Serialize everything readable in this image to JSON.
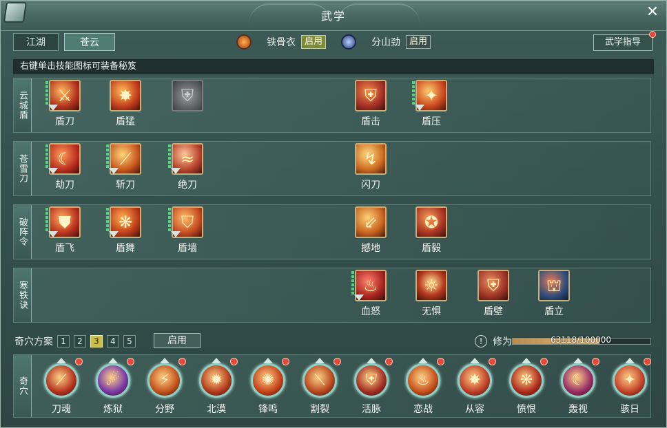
{
  "window": {
    "title": "武学"
  },
  "tabs": [
    {
      "label": "江湖"
    },
    {
      "label": "苍云"
    }
  ],
  "stances": [
    {
      "name": "铁骨衣",
      "badge": "启用",
      "icon": "shield-emblem-icon"
    },
    {
      "name": "分山劲",
      "badge": "启用",
      "icon": "blade-emblem-icon"
    }
  ],
  "guide": {
    "label": "武学指导"
  },
  "hint": "右键单击技能图标可装备秘笈",
  "rows": [
    {
      "label": "云城盾",
      "skills": [
        {
          "name": "盾刀",
          "color": "#b3331e"
        },
        {
          "name": "盾猛",
          "color": "#c23d1d"
        },
        {
          "name": "",
          "color": "#6d6f70"
        },
        {
          "name": "盾击",
          "color": "#a32f27"
        },
        {
          "name": "盾压",
          "color": "#c9471f"
        }
      ]
    },
    {
      "label": "苍雪刀",
      "skills": [
        {
          "name": "劫刀",
          "color": "#bb2e1f"
        },
        {
          "name": "斩刀",
          "color": "#c8571f"
        },
        {
          "name": "绝刀",
          "color": "#b8432d"
        },
        {
          "name": "闪刀",
          "color": "#cc6a1f"
        }
      ]
    },
    {
      "label": "破阵令",
      "skills": [
        {
          "name": "盾飞",
          "color": "#b9331f"
        },
        {
          "name": "盾舞",
          "color": "#be3c1b"
        },
        {
          "name": "盾墙",
          "color": "#c44a22"
        },
        {
          "name": "撼地",
          "color": "#c6621f"
        },
        {
          "name": "盾毅",
          "color": "#a93323"
        }
      ]
    },
    {
      "label": "寒铁诀",
      "skills": [
        {
          "name": "血怒",
          "color": "#a82520"
        },
        {
          "name": "无惧",
          "color": "#b83a20"
        },
        {
          "name": "盾壁",
          "color": "#9c3326"
        },
        {
          "name": "盾立",
          "color": "#2e4d7c"
        }
      ]
    }
  ],
  "scheme": {
    "label": "奇穴方案",
    "options": [
      "1",
      "2",
      "3",
      "4",
      "5"
    ],
    "active": "3",
    "enable_label": "启用"
  },
  "cultivation": {
    "label": "修为",
    "current": 63118,
    "max": 100000,
    "text": "63118/100000",
    "info": "!"
  },
  "qixue": {
    "label": "奇穴",
    "items": [
      {
        "name": "刀魂",
        "color": "#b6351f"
      },
      {
        "name": "炼狱",
        "color": "#7b3aa8"
      },
      {
        "name": "分野",
        "color": "#c4541c"
      },
      {
        "name": "北漠",
        "color": "#b53d1e"
      },
      {
        "name": "锋鸣",
        "color": "#c7441a"
      },
      {
        "name": "割裂",
        "color": "#b8481f"
      },
      {
        "name": "活脉",
        "color": "#a23024"
      },
      {
        "name": "恋战",
        "color": "#c6521c"
      },
      {
        "name": "从容",
        "color": "#c0402a"
      },
      {
        "name": "愤恨",
        "color": "#b02d1f"
      },
      {
        "name": "轰视",
        "color": "#9a2e66"
      },
      {
        "name": "骇日",
        "color": "#c5442a"
      }
    ]
  }
}
